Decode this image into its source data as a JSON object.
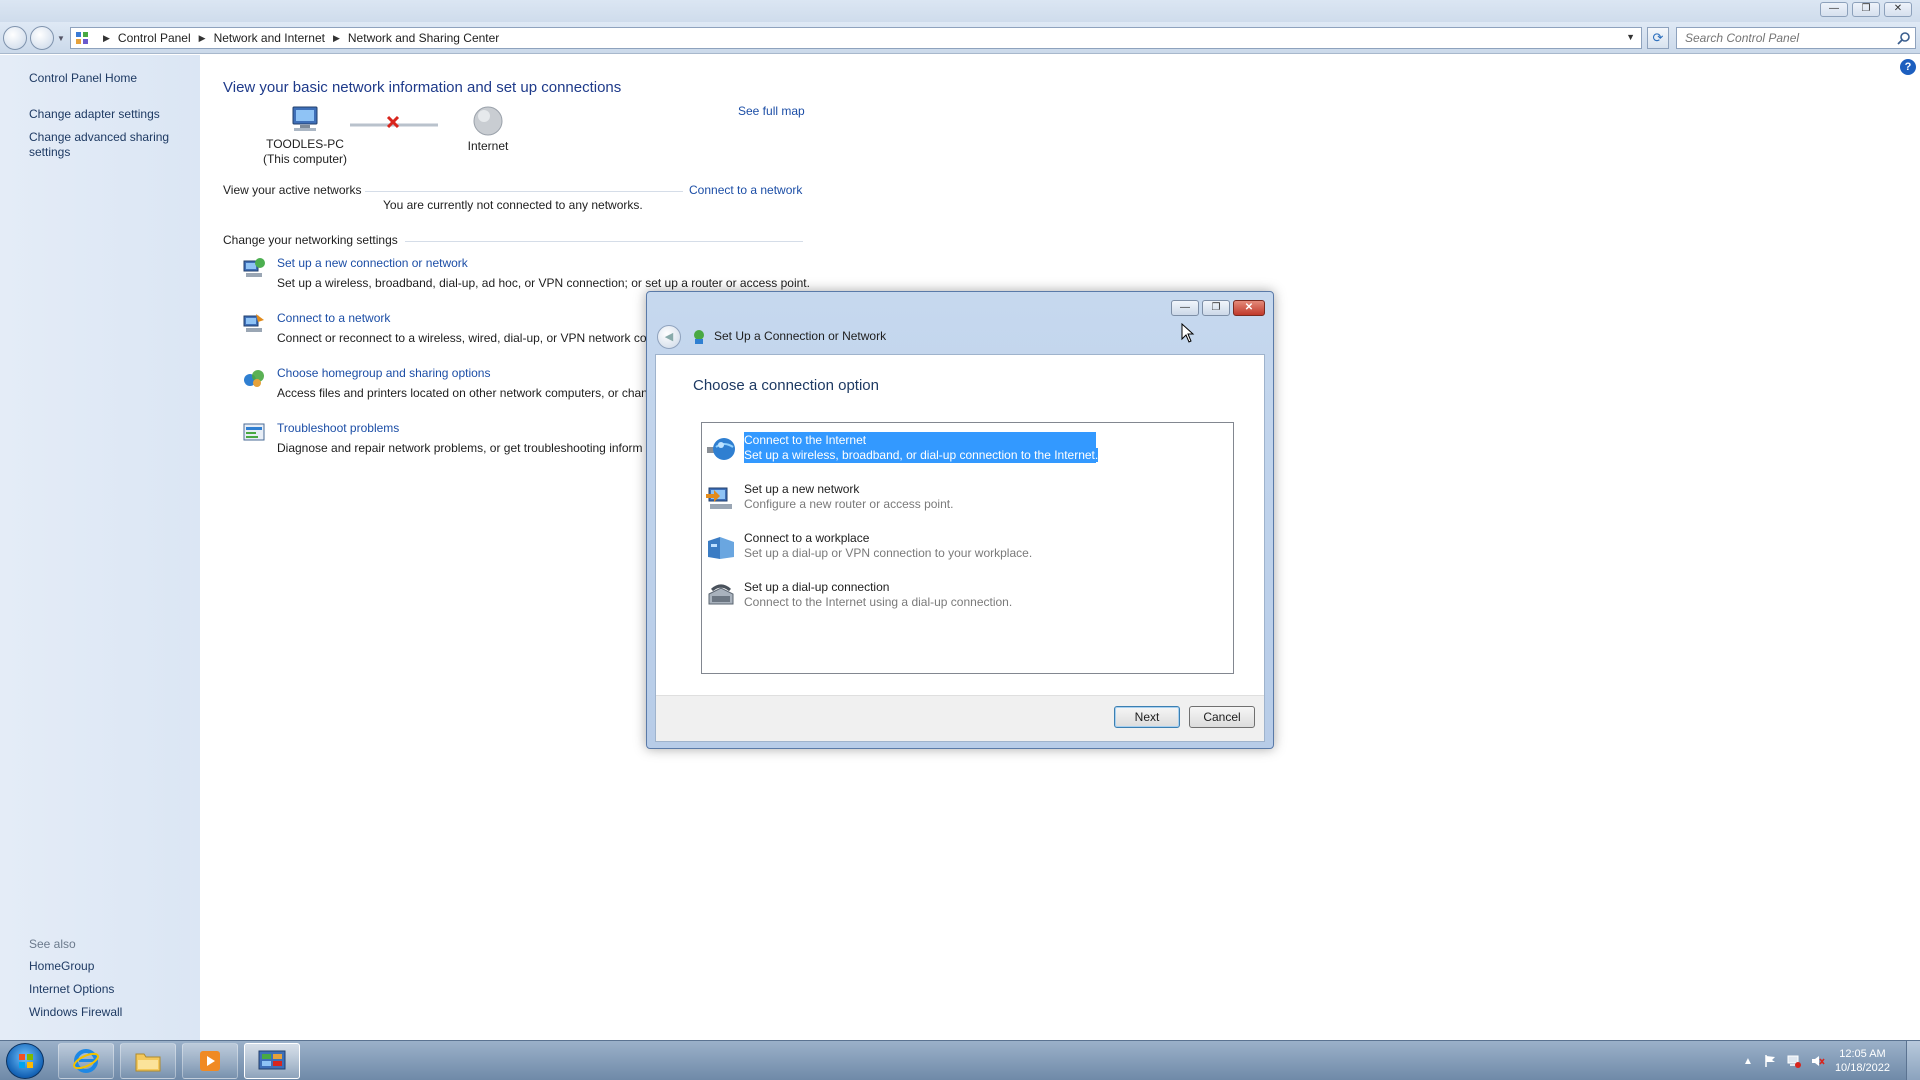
{
  "window": {
    "controls": {
      "minimize": "—",
      "restore": "❐",
      "close": "✕"
    }
  },
  "navbar": {
    "breadcrumbs": [
      "Control Panel",
      "Network and Internet",
      "Network and Sharing Center"
    ],
    "search_placeholder": "Search Control Panel"
  },
  "sidebar": {
    "home": "Control Panel Home",
    "links": [
      "Change adapter settings",
      "Change advanced sharing settings"
    ],
    "see_also_label": "See also",
    "see_also": [
      "HomeGroup",
      "Internet Options",
      "Windows Firewall"
    ]
  },
  "main": {
    "title": "View your basic network information and set up connections",
    "computer_name": "TOODLES-PC",
    "computer_sub": "(This computer)",
    "internet_label": "Internet",
    "see_full_map": "See full map",
    "active_networks_label": "View your active networks",
    "connect_link": "Connect to a network",
    "not_connected": "You are currently not connected to any networks.",
    "settings_label": "Change your networking settings",
    "tasks": [
      {
        "title": "Set up a new connection or network",
        "desc": "Set up a wireless, broadband, dial-up, ad hoc, or VPN connection; or set up a router or access point."
      },
      {
        "title": "Connect to a network",
        "desc": "Connect or reconnect to a wireless, wired, dial-up, or VPN network cor"
      },
      {
        "title": "Choose homegroup and sharing options",
        "desc": "Access files and printers located on other network computers, or chan"
      },
      {
        "title": "Troubleshoot problems",
        "desc": "Diagnose and repair network problems, or get troubleshooting inform"
      }
    ]
  },
  "dialog": {
    "title": "Set Up a Connection or Network",
    "heading": "Choose a connection option",
    "options": [
      {
        "title": "Connect to the Internet",
        "desc": "Set up a wireless, broadband, or dial-up connection to the Internet.",
        "selected": true
      },
      {
        "title": "Set up a new network",
        "desc": "Configure a new router or access point."
      },
      {
        "title": "Connect to a workplace",
        "desc": "Set up a dial-up or VPN connection to your workplace."
      },
      {
        "title": "Set up a dial-up connection",
        "desc": "Connect to the Internet using a dial-up connection."
      }
    ],
    "next": "Next",
    "cancel": "Cancel",
    "controls": {
      "minimize": "—",
      "maximize": "❐",
      "close": "✕"
    }
  },
  "taskbar": {
    "time": "12:05 AM",
    "date": "10/18/2022"
  },
  "colors": {
    "link": "#1c4ea6",
    "selection": "#3399ff",
    "title_blue": "#1e3a8a"
  }
}
